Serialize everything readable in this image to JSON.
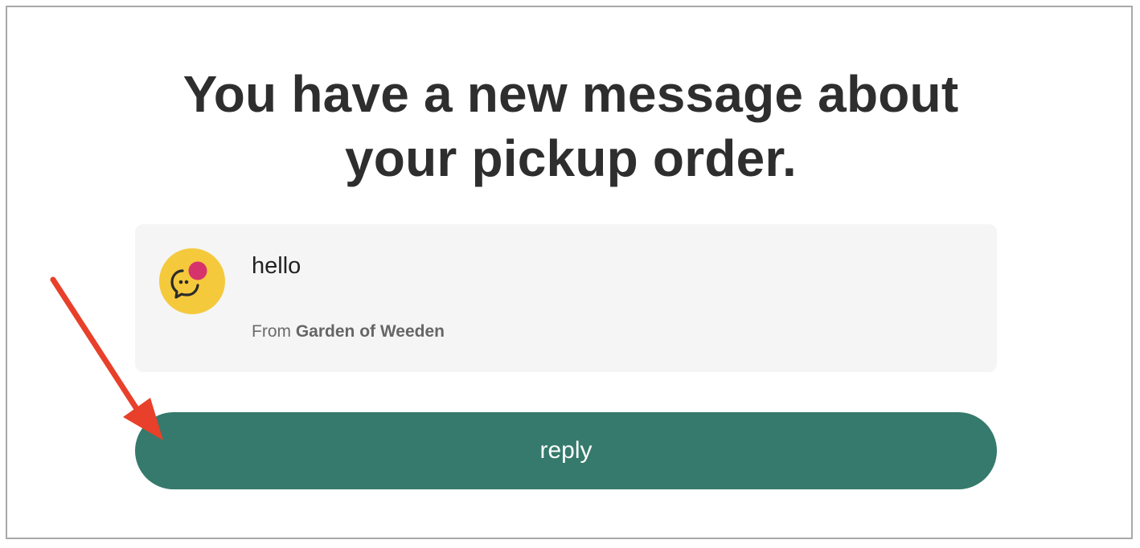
{
  "headline": {
    "line1": "You have a new message about",
    "line2": "your pickup order."
  },
  "message": {
    "avatar_icon": "chat-bubble-notification-icon",
    "text": "hello",
    "from_prefix": "From",
    "sender_name": "Garden of Weeden"
  },
  "reply_button": {
    "label": "reply"
  },
  "colors": {
    "button": "#357a6c",
    "avatar": "#f5c93c",
    "notification_dot": "#d6336c",
    "annotation_arrow": "#e8402a"
  }
}
